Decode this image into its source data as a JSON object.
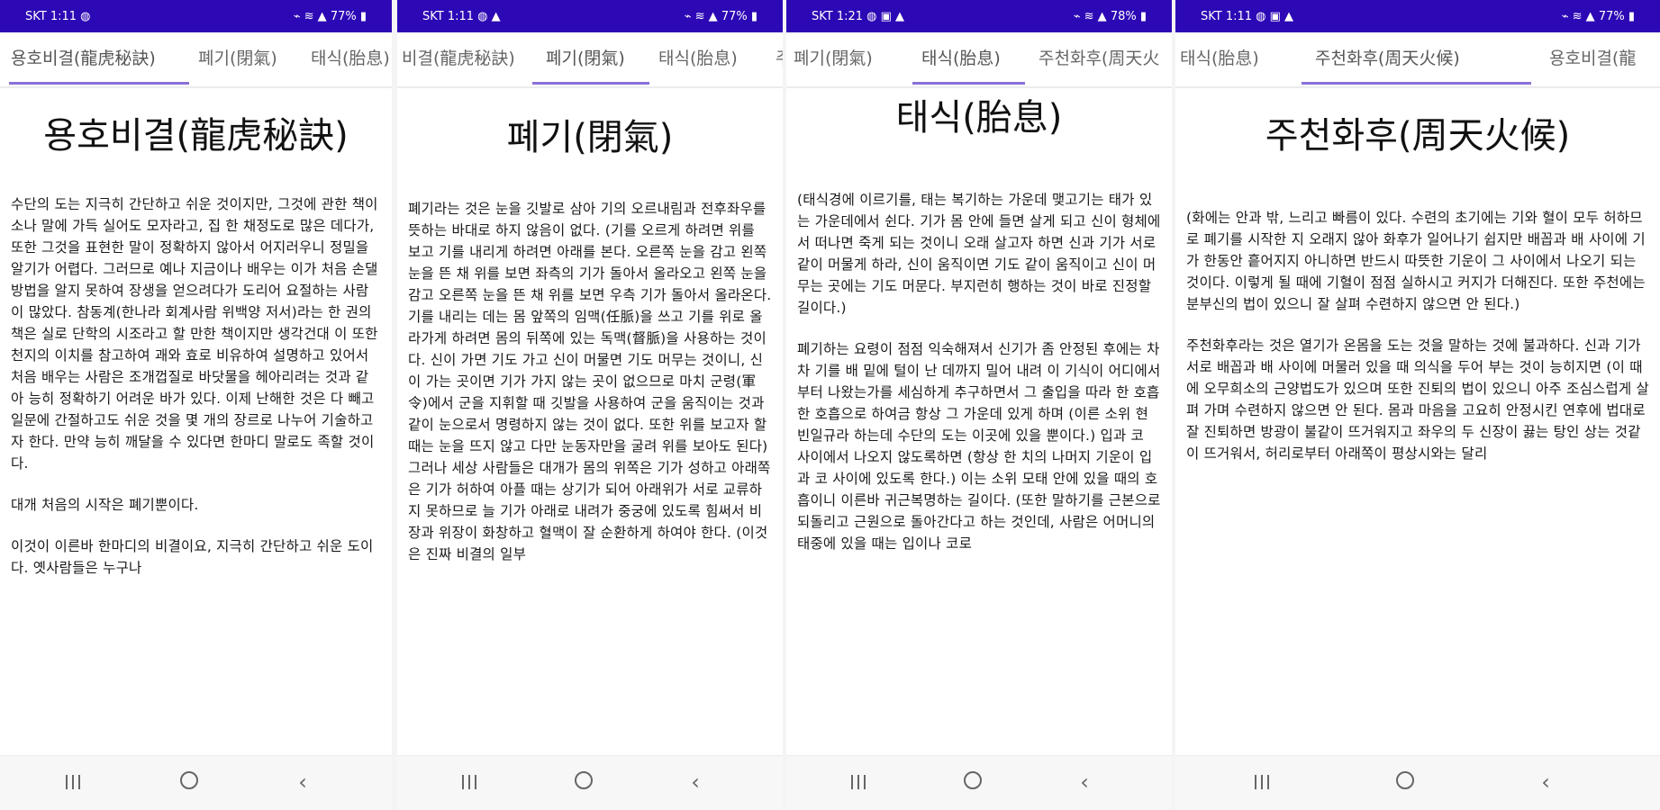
{
  "screens": [
    {
      "status": {
        "time": "SKT 1:11 ◍",
        "right": "⌁ ≋ ▲ 77% ▮"
      },
      "tabs": [
        "용호비결(龍虎秘訣)",
        "폐기(閉氣)",
        "태식(胎息)"
      ],
      "active_tab": 0,
      "title": "용호비결(龍虎秘訣)",
      "paragraphs": [
        "수단의 도는 지극히 간단하고 쉬운 것이지만, 그것에 관한 책이 소나 말에 가득 실어도 모자라고, 집 한 채정도로 많은 데다가, 또한 그것을 표현한 말이 정확하지 않아서 어지러우니 정밀을 알기가 어렵다. 그러므로 예나 지금이나 배우는 이가 처음 손댈 방법을 알지 못하여 장생을 얻으려다가 도리어 요절하는 사람이 많았다. 참동계(한나라 회계사람 위백양 저서)라는 한 권의 책은 실로 단학의 시조라고 할 만한 책이지만 생각건대 이 또한 천지의 이치를 참고하여 괘와 효로 비유하여 설명하고 있어서 처음 배우는 사람은 조개껍질로 바닷물을 헤아리려는 것과 같아 능히 정확하기 어려운 바가 있다. 이제 난해한 것은 다 빼고 일문에 간절하고도 쉬운 것을 몇 개의 장르로 나누어 기술하고자 한다. 만약 능히 깨달을 수 있다면 한마디 말로도 족할 것이다.",
        "대개 처음의 시작은 폐기뿐이다.",
        "이것이 이른바 한마디의 비결이요, 지극히 간단하고 쉬운 도이다. 옛사람들은 누구나"
      ]
    },
    {
      "status": {
        "time": "SKT 1:11 ◍ ▲",
        "right": "⌁ ≋ ▲ 77% ▮"
      },
      "tabs": [
        "비결(龍虎秘訣)",
        "폐기(閉氣)",
        "태식(胎息)",
        "주("
      ],
      "active_tab": 1,
      "title": "폐기(閉氣)",
      "paragraphs": [
        "폐기라는 것은 눈을 깃발로 삼아 기의 오르내림과 전후좌우를 뜻하는 바대로 하지 않음이 없다. (기를 오르게 하려면 위를 보고 기를 내리게 하려면 아래를 본다. 오른쪽 눈을 감고 왼쪽 눈을 뜬 채 위를 보면 좌측의 기가 돌아서 올라오고 왼쪽 눈을 감고 오른쪽 눈을 뜬 채 위를 보면 우측 기가 돌아서 올라온다. 기를 내리는 데는 몸 앞쪽의 임맥(任脈)을 쓰고 기를 위로 올라가게 하려면 몸의 뒤쪽에 있는 독맥(督脈)을 사용하는 것이다. 신이 가면 기도 가고 신이 머물면 기도 머무는 것이니, 신이 가는 곳이면 기가 가지 않는 곳이 없으므로 마치 군령(軍令)에서 군을 지휘할 때 깃발을 사용하여 군을 움직이는 것과 같이 눈으로서 명령하지 않는 것이 없다. 또한 위를 보고자 할 때는 눈을 뜨지 않고 다만 눈동자만을 굴려 위를 보아도 된다) 그러나 세상 사람들은 대개가 몸의 위쪽은 기가 성하고 아래쪽은 기가 허하여 아플 때는 상기가 되어 아래위가 서로 교류하지 못하므로 늘 기가 아래로 내려가 중궁에 있도록 힘써서 비장과 위장이 화창하고 혈맥이 잘 순환하게 하여야 한다. (이것은 진짜 비결의 일부"
      ]
    },
    {
      "status": {
        "time": "SKT 1:21 ◍ ▣ ▲",
        "right": "⌁ ≋ ▲ 78% ▮"
      },
      "tabs": [
        "폐기(閉氣)",
        "태식(胎息)",
        "주천화후(周天火"
      ],
      "active_tab": 1,
      "title": "태식(胎息)",
      "paragraphs": [
        "(태식경에 이르기를, 태는 복기하는 가운데 맺고기는 태가 있는 가운데에서 쉰다. 기가 몸 안에 들면 살게 되고 신이 형체에서 떠나면 죽게 되는 것이니 오래 살고자 하면 신과 기가 서로 같이 머물게 하라, 신이 움직이면 기도 같이 움직이고 신이 머무는 곳에는 기도 머문다. 부지런히 행하는 것이 바로 진정할 길이다.)",
        "폐기하는 요령이 점점 익숙해져서 신기가 좀 안정된 후에는 차차 기를 배 밑에 털이 난 데까지 밀어 내려 이 기식이 어디에서부터 나왔는가를 세심하게 추구하면서 그 출입을 따라 한 호흡 한 호흡으로 하여금 항상 그 가운데 있게 하며 (이른 소위 현빈일규라 하는데 수단의 도는 이곳에 있을 뿐이다.) 입과 코 사이에서 나오지 않도록하면 (항상 한 치의 나머지 기운이 입과 코 사이에 있도록 한다.) 이는 소위 모태 안에 있을 때의 호흡이니 이른바 귀근복명하는 길이다. (또한 말하기를 근본으로 되돌리고 근원으로 돌아간다고 하는 것인데, 사람은 어머니의 태중에 있을 때는 입이나 코로"
      ]
    },
    {
      "status": {
        "time": "SKT 1:11 ◍ ▣ ▲",
        "right": "⌁ ≋ ▲ 77% ▮"
      },
      "tabs": [
        "태식(胎息)",
        "주천화후(周天火候)",
        "용호비결(龍"
      ],
      "active_tab": 1,
      "title": "주천화후(周天火候)",
      "paragraphs": [
        "(화에는 안과 밖, 느리고 빠름이 있다. 수련의 초기에는 기와 혈이 모두 허하므로 폐기를 시작한 지 오래지 않아 화후가 일어나기 쉽지만 배꼽과 배 사이에 기가 한동안 흩어지지 아니하면 반드시 따뜻한 기운이 그 사이에서 나오기 되는 것이다. 이렇게 될 때에 기혈이 점점 실하시고 커지가 더해진다. 또한 주천에는 분부신의 법이 있으니 잘 살펴 수련하지 않으면 안 된다.)",
        "주천화후라는 것은 열기가 온몸을 도는 것을 말하는 것에 불과하다. 신과 기가 서로 배꼽과 배 사이에 머물러 있을 때 의식을 두어 부는 것이 능히지면 (이 때에 오무희소의 근양법도가 있으며 또한 진퇴의 법이 있으니 아주 조심스럽게 살펴 가며 수련하지 않으면 안 된다. 몸과 마음을 고요히 안정시킨 연후에 법대로 잘 진퇴하면 방광이 불같이 뜨거워지고 좌우의 두 신장이 끓는 탕인 상는 것같이 뜨거워서, 허리로부터 아래쪽이 평상시와는 달리"
      ]
    }
  ]
}
